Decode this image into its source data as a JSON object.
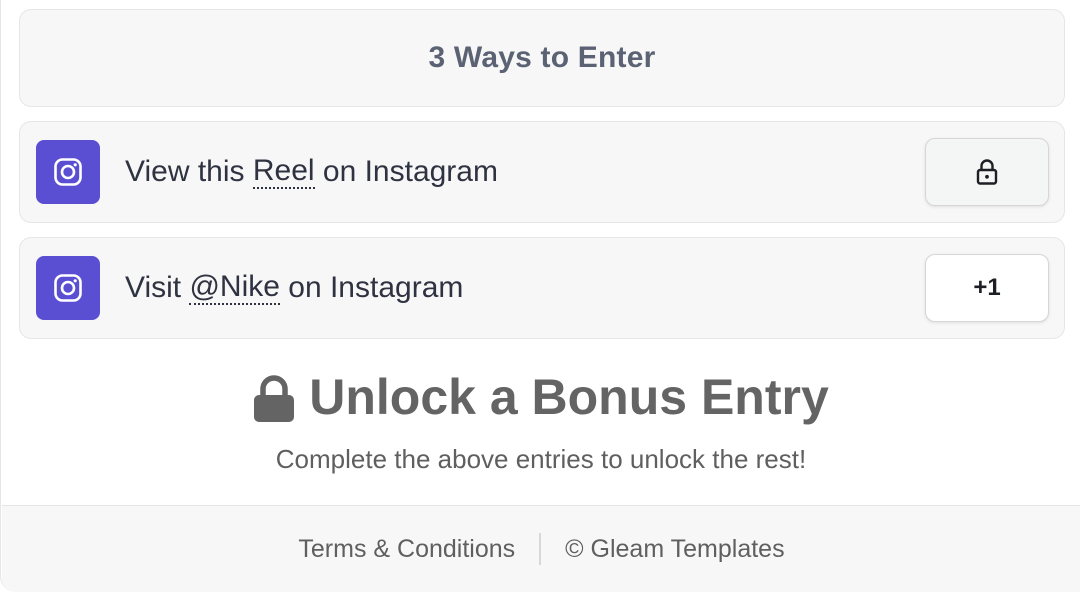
{
  "header": {
    "title": "3 Ways to Enter"
  },
  "entries": [
    {
      "icon": "instagram-icon",
      "prefix": "View this ",
      "link": "Reel",
      "suffix": " on Instagram",
      "action_icon": "lock-icon",
      "action_label": ""
    },
    {
      "icon": "instagram-icon",
      "prefix": "Visit ",
      "link": "@Nike",
      "suffix": " on Instagram",
      "action_icon": "",
      "action_label": "+1"
    }
  ],
  "bonus": {
    "icon": "lock-icon",
    "title": "Unlock a Bonus Entry",
    "subtitle": "Complete the above entries to unlock the rest!"
  },
  "footer": {
    "terms_label": "Terms & Conditions",
    "copyright_label": "© Gleam Templates"
  },
  "colors": {
    "instagram_tile": "#5a4fd3",
    "header_text": "#5b6274",
    "panel_bg": "#f7f7f7",
    "border": "#e6e6e6"
  }
}
